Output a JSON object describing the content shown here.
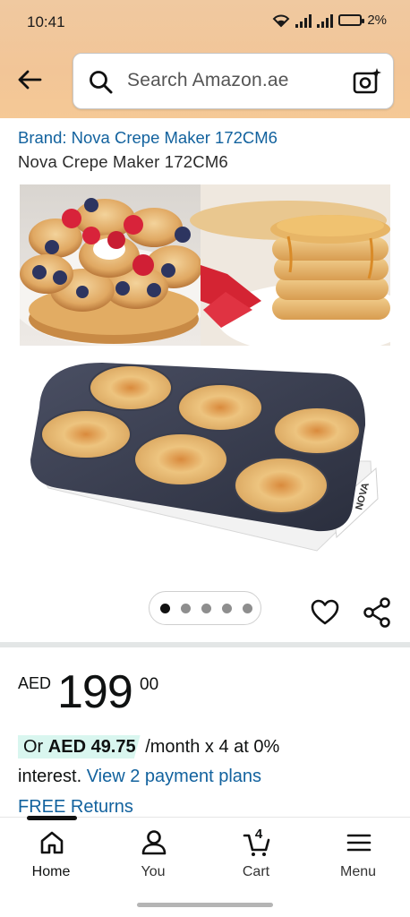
{
  "status_bar": {
    "time": "10:41",
    "battery": "2%"
  },
  "header": {
    "search_placeholder": "Search Amazon.ae",
    "icons": [
      "back-arrow-icon",
      "search-icon",
      "camera-search-icon"
    ]
  },
  "product": {
    "brand_link": "Brand: Nova Crepe Maker 172CM6",
    "title": "Nova Crepe Maker 172CM6",
    "image_count": 5,
    "active_image": 1,
    "grill_brand_mark": "NOVA"
  },
  "price": {
    "currency": "AED",
    "whole": "199",
    "fraction": "00"
  },
  "installment": {
    "prefix": "Or ",
    "amount": "AED 49.75",
    "terms": "/month x 4 at 0%",
    "line2": "interest. ",
    "link": "View 2 payment plans"
  },
  "returns": {
    "label": "FREE Returns"
  },
  "bottom_nav": {
    "items": [
      {
        "label": "Home",
        "icon": "home-icon",
        "active": true
      },
      {
        "label": "You",
        "icon": "user-icon",
        "active": false
      },
      {
        "label": "Cart",
        "icon": "cart-icon",
        "active": false,
        "count": "4"
      },
      {
        "label": "Menu",
        "icon": "menu-icon",
        "active": false
      }
    ]
  },
  "colors": {
    "header_bg": "#f2c597",
    "link": "#12629e",
    "installment_highlight": "#d9f6ef",
    "text": "#0f1111"
  }
}
